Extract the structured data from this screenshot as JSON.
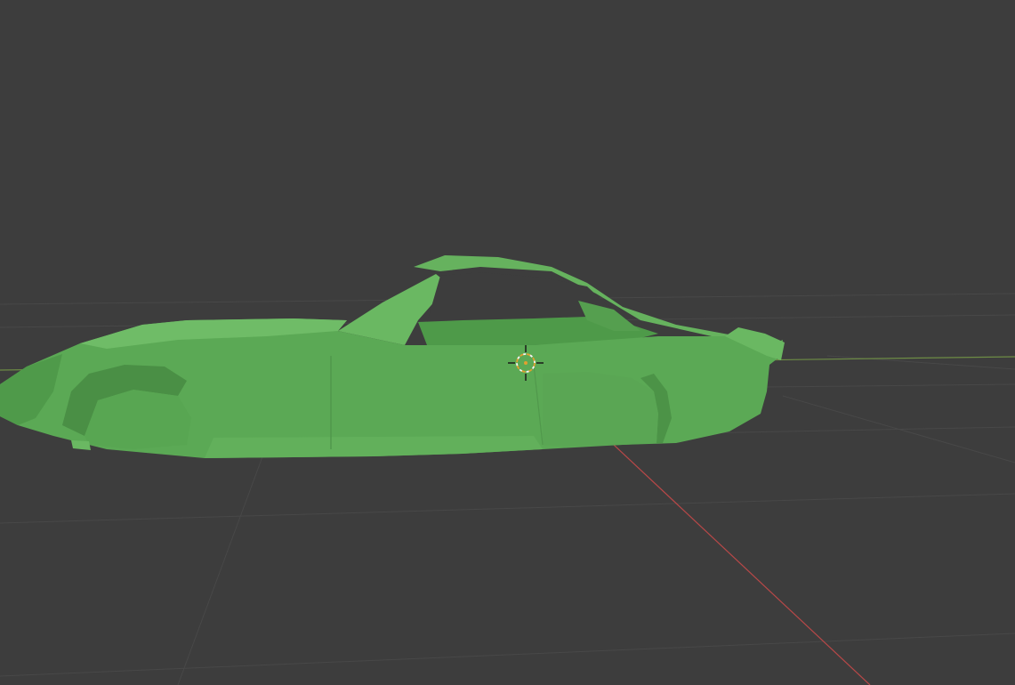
{
  "viewport": {
    "background_color": "#3d3d3d",
    "grid_color": "#4a4a4a",
    "x_axis_color": "#c24c4c",
    "y_axis_color": "#7a9a4a",
    "model_color": "#5aa454",
    "model_shadow_color": "#3f7d3b",
    "model_highlight_color": "#7bc46f",
    "cursor_icon": "3d-cursor-icon"
  }
}
